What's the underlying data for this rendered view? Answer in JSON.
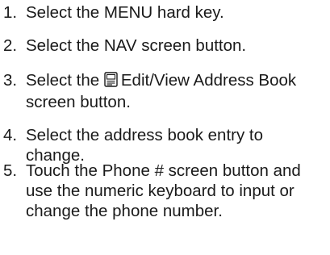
{
  "steps": [
    {
      "number": "1.",
      "text": "Select the MENU hard key."
    },
    {
      "number": "2.",
      "text": "Select the NAV screen button."
    },
    {
      "number": "3.",
      "text_before": "Select the",
      "icon": "address-book-icon",
      "text_after": "Edit/View Address Book screen button."
    },
    {
      "number": "4.",
      "text": "Select the address book entry to change."
    },
    {
      "number": "5.",
      "text": "Touch the Phone # screen button and use the numeric keyboard to input or change the phone number."
    }
  ]
}
